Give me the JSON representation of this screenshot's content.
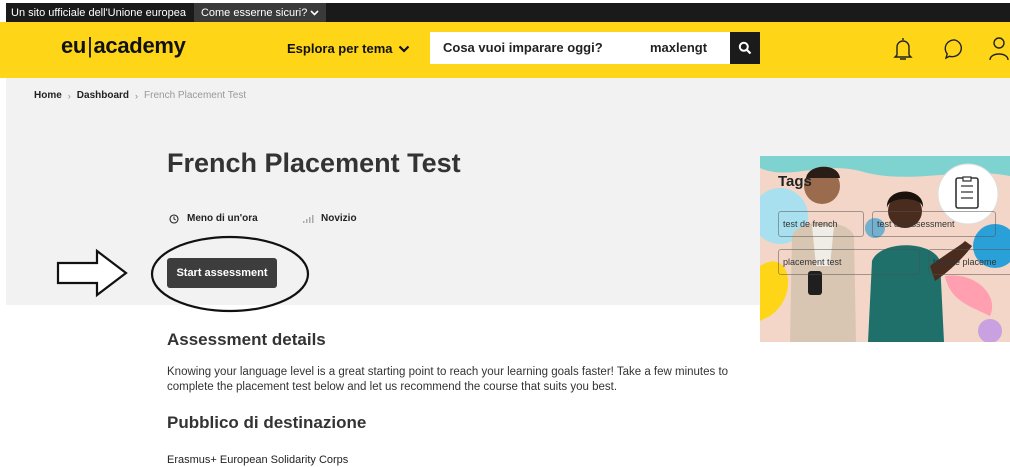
{
  "eu_bar": {
    "official_text": "Un sito ufficiale dell'Unione europea",
    "how_sure_label": "Come esserne sicuri?"
  },
  "header": {
    "logo_left": "eu",
    "logo_right": "academy",
    "explore_label": "Esplora per tema",
    "search_placeholder": "Cosa vuoi imparare oggi?",
    "search_value": "maxlengt",
    "brand_color": "#ffd617"
  },
  "breadcrumb": {
    "home": "Home",
    "dashboard": "Dashboard",
    "current": "French Placement Test"
  },
  "course": {
    "title": "French Placement Test",
    "duration": "Meno di un'ora",
    "level": "Novizio",
    "start_label": "Start assessment"
  },
  "tags_card": {
    "title": "Tags",
    "tags": [
      "test de french",
      "test de assessment",
      "placement test",
      "test de placeme"
    ]
  },
  "details": {
    "heading": "Assessment details",
    "text": "Knowing your language level is a great starting point to reach your learning goals faster! Take a few minutes to complete the placement test below and let us recommend the course that suits you best."
  },
  "audience": {
    "heading": "Pubblico di destinazione",
    "text": "Erasmus+ European Solidarity Corps"
  }
}
